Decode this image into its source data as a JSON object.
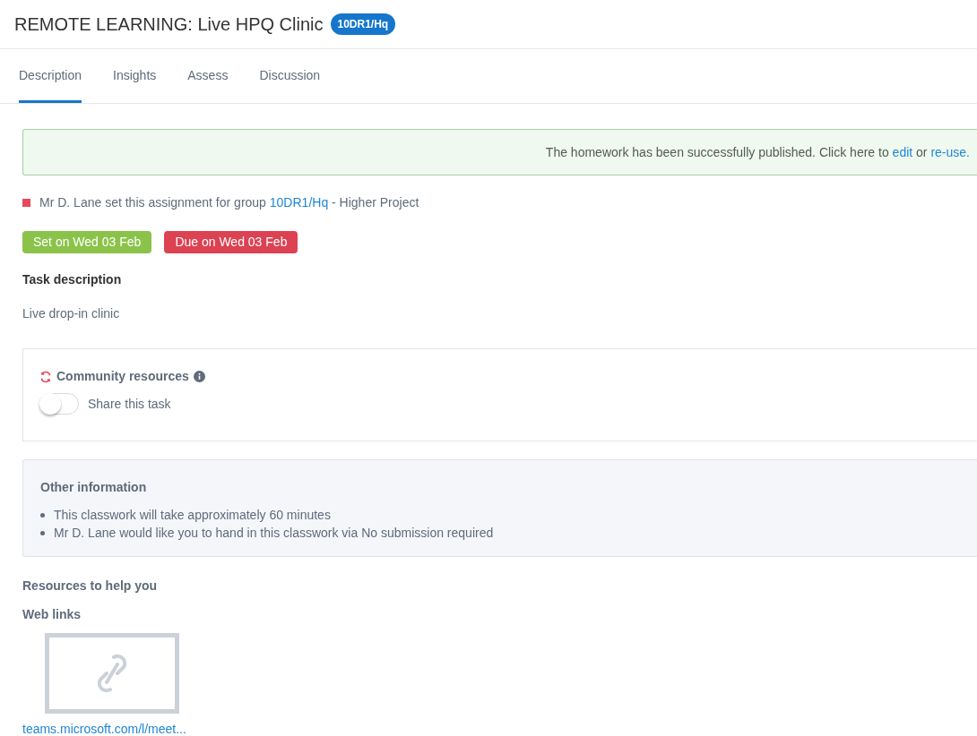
{
  "header": {
    "title": "REMOTE LEARNING: Live HPQ Clinic",
    "badge": "10DR1/Hq"
  },
  "tabs": [
    {
      "label": "Description",
      "selected": true
    },
    {
      "label": "Insights",
      "selected": false
    },
    {
      "label": "Assess",
      "selected": false
    },
    {
      "label": "Discussion",
      "selected": false
    }
  ],
  "banner": {
    "text": "The homework has been successfully published. Click here to",
    "link_1": "edit",
    "middle": "or",
    "link_2": "re-use."
  },
  "set_by": {
    "text": "Mr D. Lane set this assignment for group",
    "group_link": "10DR1/Hq",
    "suffix": "- Higher Project"
  },
  "dates": [
    {
      "kind": "set",
      "label": "Set on Wed 03 Feb"
    },
    {
      "kind": "due",
      "label": "Due on Wed 03 Feb"
    }
  ],
  "task": {
    "heading": "Task description",
    "text": "Live drop-in clinic"
  },
  "community": {
    "title": "Community resources",
    "share_label": "Share this task",
    "share_on": false
  },
  "other_info": {
    "heading": "Other information",
    "items": [
      "This classwork will take approximately 60 minutes",
      "Mr D. Lane would like you to hand in this classwork via No submission required"
    ]
  },
  "resources": {
    "heading": "Resources to help you",
    "subheading": "Web links",
    "links": [
      {
        "label": "teams.microsoft.com/l/meet..."
      }
    ]
  }
}
